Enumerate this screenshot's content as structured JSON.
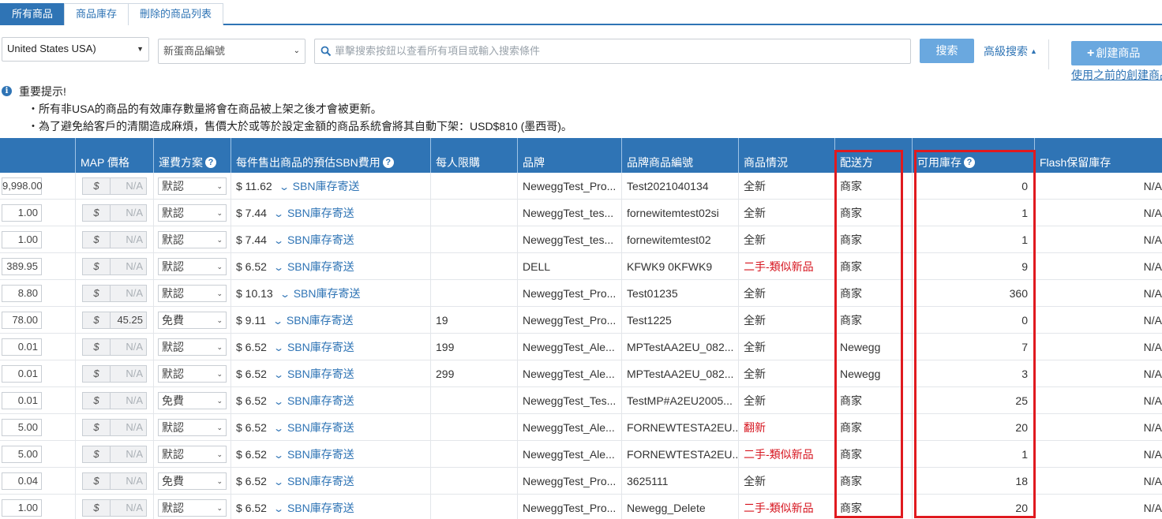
{
  "tabs": [
    {
      "label": "所有商品",
      "active": true
    },
    {
      "label": "商品庫存",
      "active": false
    },
    {
      "label": "刪除的商品列表",
      "active": false
    }
  ],
  "toolbar": {
    "country_value": "United States USA)",
    "id_type_value": "新蛋商品編號",
    "search_placeholder": "單擊搜索按鈕以查看所有項目或輸入搜索條件",
    "search_button": "搜索",
    "advanced_search": "高級搜索",
    "create_button": "創建商品",
    "prev_link": "使用之前的創建商品"
  },
  "notice": {
    "title": "重要提示!",
    "line1": "・所有非USA的商品的有效庫存數量將會在商品被上架之後才會被更新。",
    "line2": "・為了避免給客戶的清關造成麻煩，售價大於或等於設定金額的商品系統會將其自動下架：USD$810 (墨西哥)。"
  },
  "columns": {
    "price": "",
    "map": "MAP 價格",
    "shipping": "運費方案",
    "sbn_fee": "每件售出商品的預估SBN費用",
    "limit": "每人限購",
    "brand": "品牌",
    "brand_sku": "品牌商品編號",
    "condition": "商品情況",
    "fulfilled_by": "配送方",
    "inventory": "可用庫存",
    "flash": "Flash保留庫存"
  },
  "map_currency": "$",
  "sbn_label": "SBN庫存寄送",
  "rows": [
    {
      "price": "9,998.00",
      "map": "N/A",
      "shipping": "默認",
      "fee": "$ 11.62",
      "limit": "",
      "brand": "NeweggTest_Pro...",
      "sku": "Test2021040134",
      "condition": "全新",
      "cond_red": false,
      "fulfilled": "商家",
      "inventory": "0",
      "flash": "N/A"
    },
    {
      "price": "1.00",
      "map": "N/A",
      "shipping": "默認",
      "fee": "$ 7.44",
      "limit": "",
      "brand": "NeweggTest_tes...",
      "sku": "fornewitemtest02si",
      "condition": "全新",
      "cond_red": false,
      "fulfilled": "商家",
      "inventory": "1",
      "flash": "N/A"
    },
    {
      "price": "1.00",
      "map": "N/A",
      "shipping": "默認",
      "fee": "$ 7.44",
      "limit": "",
      "brand": "NeweggTest_tes...",
      "sku": "fornewitemtest02",
      "condition": "全新",
      "cond_red": false,
      "fulfilled": "商家",
      "inventory": "1",
      "flash": "N/A"
    },
    {
      "price": "389.95",
      "map": "N/A",
      "shipping": "默認",
      "fee": "$ 6.52",
      "limit": "",
      "brand": "DELL",
      "sku": "KFWK9 0KFWK9",
      "condition": "二手-類似新品",
      "cond_red": true,
      "fulfilled": "商家",
      "inventory": "9",
      "flash": "N/A"
    },
    {
      "price": "8.80",
      "map": "N/A",
      "shipping": "默認",
      "fee": "$ 10.13",
      "limit": "",
      "brand": "NeweggTest_Pro...",
      "sku": "Test01235",
      "condition": "全新",
      "cond_red": false,
      "fulfilled": "商家",
      "inventory": "360",
      "flash": "N/A"
    },
    {
      "price": "78.00",
      "map": "45.25",
      "shipping": "免費",
      "fee": "$ 9.11",
      "limit": "19",
      "brand": "NeweggTest_Pro...",
      "sku": "Test1225",
      "condition": "全新",
      "cond_red": false,
      "fulfilled": "商家",
      "inventory": "0",
      "flash": "N/A"
    },
    {
      "price": "0.01",
      "map": "N/A",
      "shipping": "默認",
      "fee": "$ 6.52",
      "limit": "199",
      "brand": "NeweggTest_Ale...",
      "sku": "MPTestAA2EU_082...",
      "condition": "全新",
      "cond_red": false,
      "fulfilled": "Newegg",
      "inventory": "7",
      "flash": "N/A"
    },
    {
      "price": "0.01",
      "map": "N/A",
      "shipping": "默認",
      "fee": "$ 6.52",
      "limit": "299",
      "brand": "NeweggTest_Ale...",
      "sku": "MPTestAA2EU_082...",
      "condition": "全新",
      "cond_red": false,
      "fulfilled": "Newegg",
      "inventory": "3",
      "flash": "N/A"
    },
    {
      "price": "0.01",
      "map": "N/A",
      "shipping": "免費",
      "fee": "$ 6.52",
      "limit": "",
      "brand": "NeweggTest_Tes...",
      "sku": "TestMP#A2EU2005...",
      "condition": "全新",
      "cond_red": false,
      "fulfilled": "商家",
      "inventory": "25",
      "flash": "N/A"
    },
    {
      "price": "5.00",
      "map": "N/A",
      "shipping": "默認",
      "fee": "$ 6.52",
      "limit": "",
      "brand": "NeweggTest_Ale...",
      "sku": "FORNEWTESTA2EU...",
      "condition": "翻新",
      "cond_red": true,
      "fulfilled": "商家",
      "inventory": "20",
      "flash": "N/A"
    },
    {
      "price": "5.00",
      "map": "N/A",
      "shipping": "默認",
      "fee": "$ 6.52",
      "limit": "",
      "brand": "NeweggTest_Ale...",
      "sku": "FORNEWTESTA2EU...",
      "condition": "二手-類似新品",
      "cond_red": true,
      "fulfilled": "商家",
      "inventory": "1",
      "flash": "N/A"
    },
    {
      "price": "0.04",
      "map": "N/A",
      "shipping": "免費",
      "fee": "$ 6.52",
      "limit": "",
      "brand": "NeweggTest_Pro...",
      "sku": "3625111",
      "condition": "全新",
      "cond_red": false,
      "fulfilled": "商家",
      "inventory": "18",
      "flash": "N/A"
    },
    {
      "price": "1.00",
      "map": "N/A",
      "shipping": "默認",
      "fee": "$ 6.52",
      "limit": "",
      "brand": "NeweggTest_Pro...",
      "sku": "Newegg_Delete",
      "condition": "二手-類似新品",
      "cond_red": true,
      "fulfilled": "商家",
      "inventory": "20",
      "flash": "N/A"
    }
  ],
  "colors": {
    "header_blue": "#2f74b5",
    "highlight_red": "#e01a1f",
    "condition_red": "#d6141e"
  }
}
